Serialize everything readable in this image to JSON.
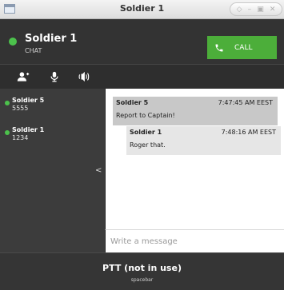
{
  "window": {
    "title": "Soldier 1"
  },
  "header": {
    "name": "Soldier 1",
    "subtitle": "CHAT",
    "call_label": "CALL",
    "status_color": "#4cc24c",
    "call_color": "#4cae3a"
  },
  "toolbar": {
    "icons": [
      "add-user-icon",
      "microphone-icon",
      "speaker-icon"
    ]
  },
  "sidebar": {
    "contacts": [
      {
        "name": "Soldier 5",
        "number": "5555",
        "status": "online"
      },
      {
        "name": "Soldier 1",
        "number": "1234",
        "status": "online"
      }
    ],
    "collapse_glyph": "<"
  },
  "chat": {
    "messages": [
      {
        "sender": "Soldier 5",
        "time": "7:47:45 AM EEST",
        "text": "Report to Captain!"
      },
      {
        "sender": "Soldier 1",
        "time": "7:48:16 AM EEST",
        "text": "Roger that."
      }
    ],
    "input_placeholder": "Write a message"
  },
  "footer": {
    "ptt_label": "PTT (not in use)",
    "ptt_key": "spacebar"
  }
}
